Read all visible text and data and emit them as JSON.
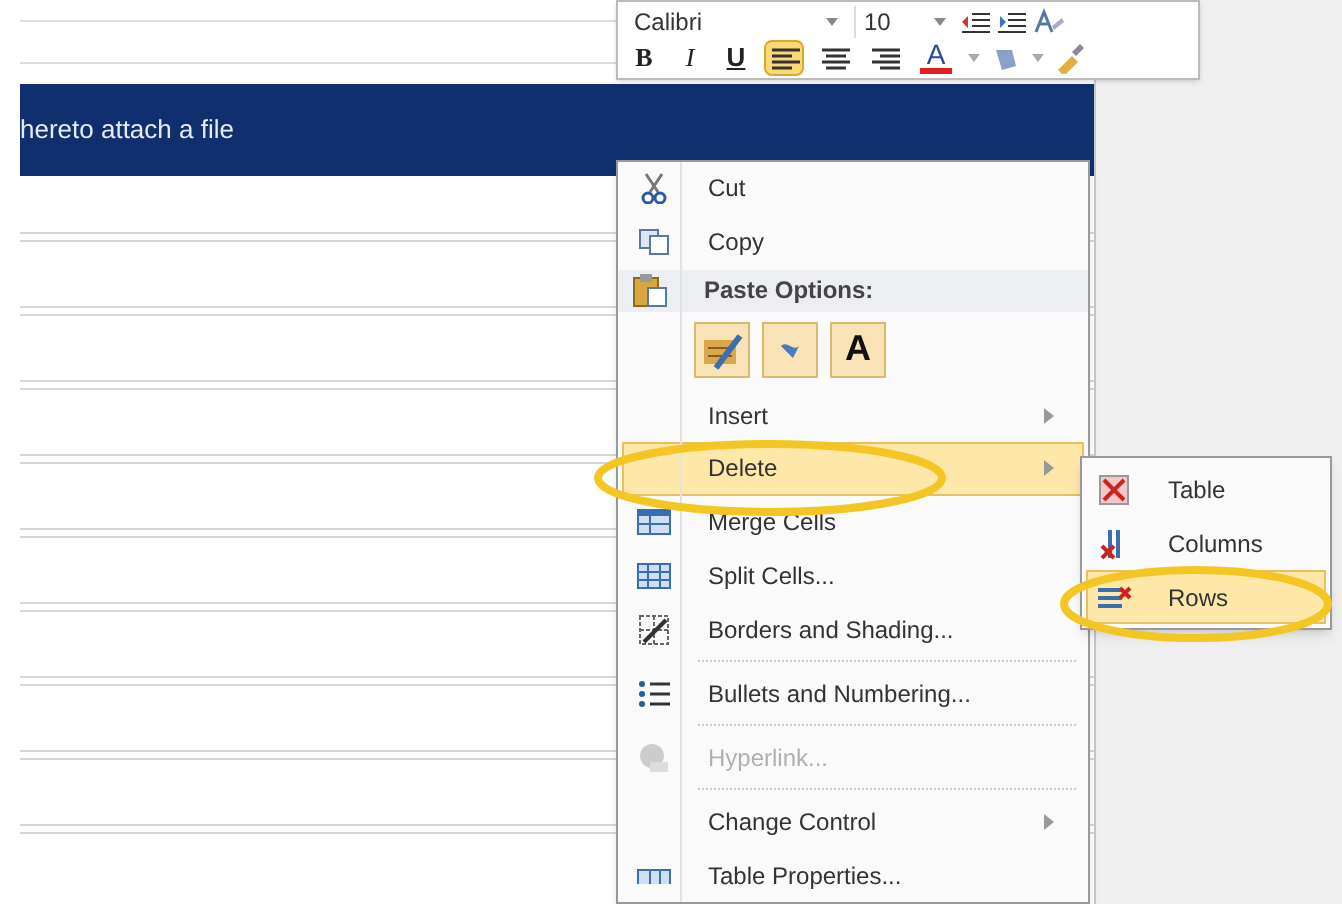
{
  "banner": {
    "text": "hereto attach a file"
  },
  "mini_toolbar": {
    "font": "Calibri",
    "size": "10",
    "format_buttons": [
      {
        "kind": "text",
        "label": "B",
        "selected": false
      },
      {
        "kind": "text",
        "label": "I",
        "selected": false
      },
      {
        "kind": "text",
        "label": "U",
        "selected": false
      },
      {
        "kind": "align",
        "selected": true
      },
      {
        "kind": "align",
        "selected": false
      },
      {
        "kind": "align",
        "selected": false
      },
      {
        "kind": "color",
        "label": "A",
        "selected": false
      }
    ]
  },
  "context_menu": {
    "items": [
      {
        "kind": "item",
        "label": "Cut",
        "disabled": false,
        "selected": false,
        "submenu": false
      },
      {
        "kind": "item",
        "label": "Copy",
        "disabled": false,
        "selected": false,
        "submenu": false
      },
      {
        "kind": "header",
        "label": "Paste Options:"
      },
      {
        "kind": "paste",
        "label": "A"
      },
      {
        "kind": "item",
        "label": "Insert",
        "disabled": false,
        "selected": false,
        "submenu": true
      },
      {
        "kind": "item",
        "label": "Delete",
        "disabled": false,
        "selected": true,
        "submenu": true
      },
      {
        "kind": "item",
        "label": "Merge Cells",
        "disabled": false,
        "selected": false,
        "submenu": false
      },
      {
        "kind": "item",
        "label": "Split Cells...",
        "disabled": false,
        "selected": false,
        "submenu": false
      },
      {
        "kind": "item",
        "label": "Borders and Shading...",
        "disabled": false,
        "selected": false,
        "submenu": false
      },
      {
        "kind": "item",
        "label": "Bullets and Numbering...",
        "disabled": false,
        "selected": false,
        "submenu": false
      },
      {
        "kind": "item",
        "label": "Hyperlink...",
        "disabled": true,
        "selected": false,
        "submenu": false
      },
      {
        "kind": "item",
        "label": "Change Control",
        "disabled": false,
        "selected": false,
        "submenu": true
      },
      {
        "kind": "item",
        "label": "Table Properties...",
        "disabled": false,
        "selected": false,
        "submenu": false
      }
    ]
  },
  "submenu": {
    "items": [
      {
        "label": "Table",
        "selected": false
      },
      {
        "label": "Columns",
        "selected": false
      },
      {
        "label": "Rows",
        "selected": true
      }
    ]
  }
}
